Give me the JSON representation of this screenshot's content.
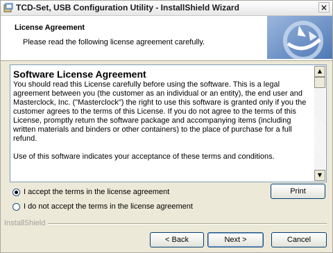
{
  "window": {
    "title": "TCD-Set, USB Configuration Utility - InstallShield Wizard",
    "close_glyph": "×"
  },
  "header": {
    "title": "License Agreement",
    "subtitle": "Please read the following license agreement carefully."
  },
  "license": {
    "heading": "Software License Agreement",
    "paragraphs": [
      "You should read this License carefully before using the software. This is a legal agreement between you (the customer as an individual or an entity), the end user and Masterclock, Inc. (\"Masterclock\") the right to use this software is granted only if you the customer agrees to the terms of this License. If you do not agree to the terms of this License, promptly return the software package and accompanying items (including written materials and binders or other containers) to the place of purchase for a full refund.",
      "Use of this software indicates your acceptance of these terms and conditions."
    ],
    "scroll_up_glyph": "▲",
    "scroll_down_glyph": "▼"
  },
  "options": {
    "accept_label": "I accept the terms in the license agreement",
    "decline_label": "I do not accept the terms in the license agreement",
    "selected": "accept"
  },
  "buttons": {
    "print": "Print",
    "back": "< Back",
    "next": "Next >",
    "cancel": "Cancel"
  },
  "footer": {
    "brand": "InstallShield"
  },
  "icons": {
    "app": "installer-app-icon",
    "header_logo": "installshield-logo-icon",
    "close": "close-icon"
  },
  "colors": {
    "dialog_bg": "#ece9d8",
    "header_bg": "#ffffff",
    "logo_blue": "#6b8fc4"
  }
}
